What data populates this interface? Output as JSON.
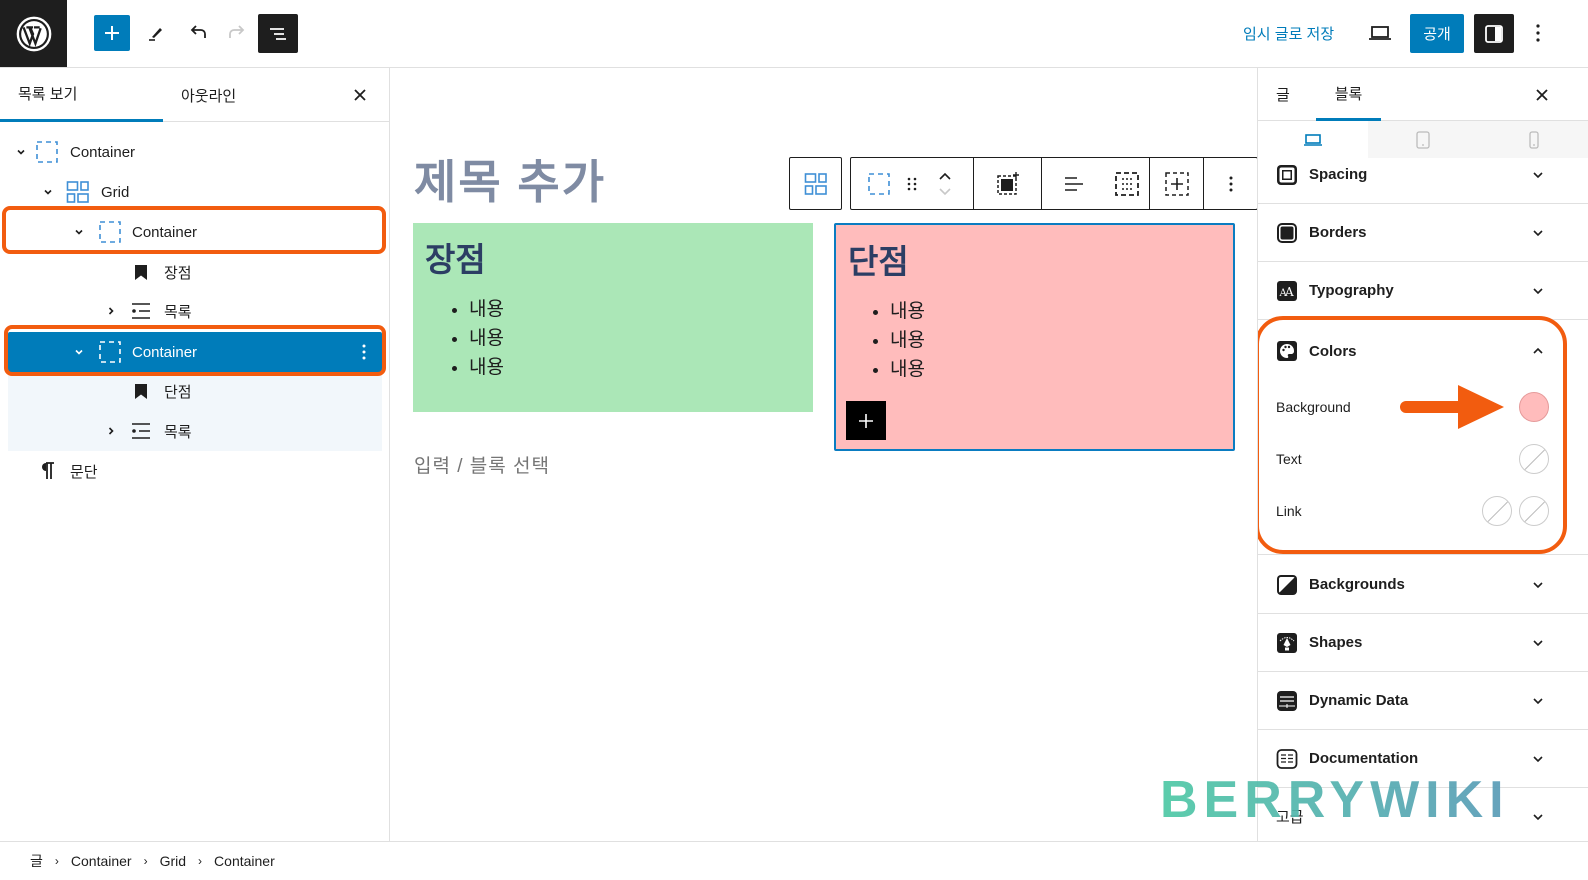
{
  "header": {
    "save_draft": "임시 글로 저장",
    "publish": "공개"
  },
  "list_view": {
    "tabs": [
      "목록 보기",
      "아웃라인"
    ],
    "items": [
      {
        "label": "Container",
        "icon": "container-icon",
        "expanded": true
      },
      {
        "label": "Grid",
        "icon": "grid-icon",
        "expanded": true
      },
      {
        "label": "Container",
        "icon": "container-icon",
        "expanded": true,
        "highlighted": true
      },
      {
        "label": "장점",
        "icon": "heading-bookmark-icon"
      },
      {
        "label": "목록",
        "icon": "list-icon",
        "expanded": false
      },
      {
        "label": "Container",
        "icon": "container-icon",
        "expanded": true,
        "selected": true,
        "highlighted": true
      },
      {
        "label": "단점",
        "icon": "heading-bookmark-icon"
      },
      {
        "label": "목록",
        "icon": "list-icon",
        "expanded": false
      },
      {
        "label": "문단",
        "icon": "paragraph-icon"
      }
    ]
  },
  "canvas": {
    "title_placeholder": "제목 추가",
    "pros": {
      "heading": "장점",
      "items": [
        "내용",
        "내용",
        "내용"
      ],
      "bg": "#abe7b7"
    },
    "cons": {
      "heading": "단점",
      "items": [
        "내용",
        "내용",
        "내용"
      ],
      "bg": "#ffbcbc"
    },
    "paragraph_placeholder": "입력 / 블록 선택"
  },
  "settings": {
    "tabs": [
      "글",
      "블록"
    ],
    "active_tab": "블록",
    "devices": [
      "desktop",
      "tablet",
      "mobile"
    ],
    "panels_top": [
      {
        "label": "Spacing",
        "icon": "spacing-icon"
      },
      {
        "label": "Borders",
        "icon": "borders-icon"
      },
      {
        "label": "Typography",
        "icon": "typography-icon"
      }
    ],
    "colors": {
      "label": "Colors",
      "rows": [
        {
          "label": "Background",
          "value": "#ffbcbc"
        },
        {
          "label": "Text",
          "value": null
        },
        {
          "label": "Link",
          "value": null
        }
      ]
    },
    "panels_bottom": [
      {
        "label": "Backgrounds",
        "icon": "backgrounds-icon"
      },
      {
        "label": "Shapes",
        "icon": "shapes-icon"
      },
      {
        "label": "Dynamic Data",
        "icon": "dynamic-data-icon"
      },
      {
        "label": "Documentation",
        "icon": "documentation-icon"
      },
      {
        "label": "고급",
        "icon": null
      }
    ]
  },
  "breadcrumb": [
    "글",
    "Container",
    "Grid",
    "Container"
  ],
  "watermark": "BERRYWIKI",
  "colors": {
    "accent": "#007cba",
    "highlight": "#f25c0f"
  }
}
